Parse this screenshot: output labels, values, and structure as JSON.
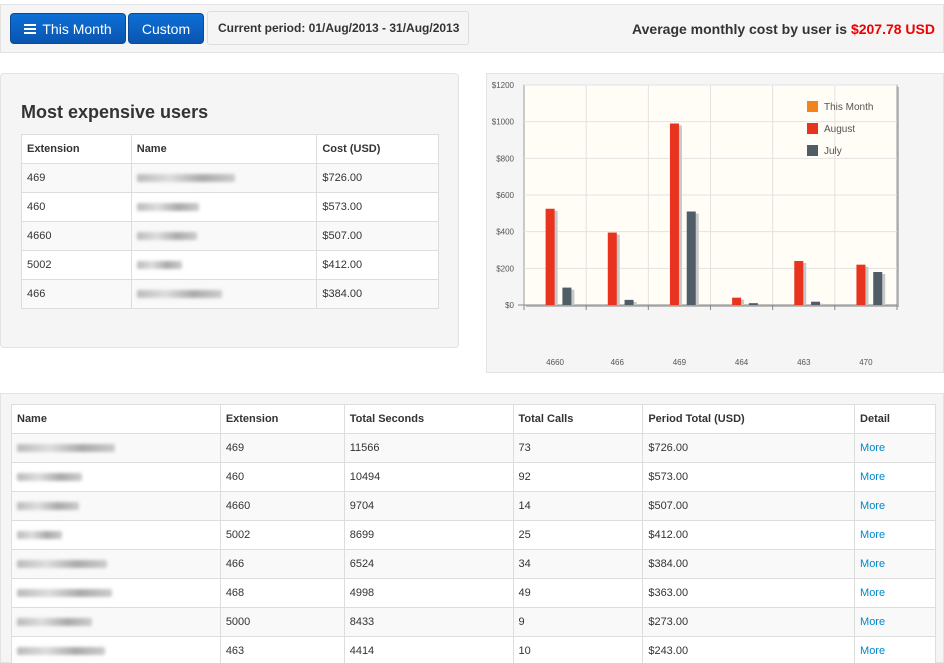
{
  "toolbar": {
    "this_month_label": "This Month",
    "custom_label": "Custom",
    "period_text": "Current period: 01/Aug/2013 - 31/Aug/2013",
    "avg_label": "Average monthly cost by user is",
    "avg_value": "$207.78 USD"
  },
  "expensive": {
    "title": "Most expensive users",
    "headers": [
      "Extension",
      "Name",
      "Cost (USD)"
    ],
    "rows": [
      {
        "extension": "469",
        "cost": "$726.00"
      },
      {
        "extension": "460",
        "cost": "$573.00"
      },
      {
        "extension": "4660",
        "cost": "$507.00"
      },
      {
        "extension": "5002",
        "cost": "$412.00"
      },
      {
        "extension": "466",
        "cost": "$384.00"
      }
    ]
  },
  "chart_data": {
    "type": "bar",
    "categories": [
      "4660",
      "466",
      "469",
      "464",
      "463",
      "470"
    ],
    "series": [
      {
        "name": "This Month",
        "color": "#f0851c",
        "values": [
          0,
          0,
          0,
          0,
          0,
          0
        ]
      },
      {
        "name": "August",
        "color": "#e8331f",
        "values": [
          525,
          395,
          990,
          40,
          240,
          220
        ]
      },
      {
        "name": "July",
        "color": "#4e5d68",
        "values": [
          95,
          28,
          510,
          10,
          18,
          180
        ]
      }
    ],
    "ylim": [
      0,
      1200
    ],
    "yticks": [
      "$0",
      "$200",
      "$400",
      "$600",
      "$800",
      "$1000",
      "$1200"
    ],
    "ytick_values": [
      0,
      200,
      400,
      600,
      800,
      1000,
      1200
    ],
    "legend": "top-right",
    "grid": true
  },
  "users": {
    "headers": [
      "Name",
      "Extension",
      "Total Seconds",
      "Total Calls",
      "Period Total (USD)",
      "Detail"
    ],
    "more_label": "More",
    "rows": [
      {
        "extension": "469",
        "seconds": "11566",
        "calls": "73",
        "total": "$726.00"
      },
      {
        "extension": "460",
        "seconds": "10494",
        "calls": "92",
        "total": "$573.00"
      },
      {
        "extension": "4660",
        "seconds": "9704",
        "calls": "14",
        "total": "$507.00"
      },
      {
        "extension": "5002",
        "seconds": "8699",
        "calls": "25",
        "total": "$412.00"
      },
      {
        "extension": "466",
        "seconds": "6524",
        "calls": "34",
        "total": "$384.00"
      },
      {
        "extension": "468",
        "seconds": "4998",
        "calls": "49",
        "total": "$363.00"
      },
      {
        "extension": "5000",
        "seconds": "8433",
        "calls": "9",
        "total": "$273.00"
      },
      {
        "extension": "463",
        "seconds": "4414",
        "calls": "10",
        "total": "$243.00"
      }
    ]
  }
}
